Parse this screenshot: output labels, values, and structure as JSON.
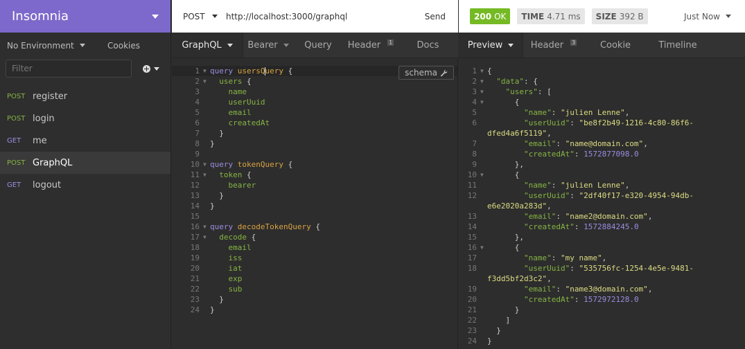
{
  "app": {
    "title": "Insomnia"
  },
  "sidebar": {
    "environment_label": "No Environment",
    "cookies_label": "Cookies",
    "filter_placeholder": "Filter",
    "requests": [
      {
        "method": "POST",
        "name": "register"
      },
      {
        "method": "POST",
        "name": "login"
      },
      {
        "method": "GET",
        "name": "me"
      },
      {
        "method": "POST",
        "name": "GraphQL",
        "active": true
      },
      {
        "method": "GET",
        "name": "logout"
      }
    ]
  },
  "request": {
    "method": "POST",
    "url": "http://localhost:3000/graphql",
    "send_label": "Send",
    "tabs": [
      {
        "label": "GraphQL",
        "active": true,
        "caret": true
      },
      {
        "label": "Bearer",
        "caret": true
      },
      {
        "label": "Query"
      },
      {
        "label": "Header",
        "badge": "1"
      },
      {
        "label": "Docs"
      }
    ],
    "schema_label": "schema"
  },
  "response": {
    "status_code": "200",
    "status_text": "OK",
    "time_label": "TIME",
    "time_value": "4.71 ms",
    "size_label": "SIZE",
    "size_value": "392 B",
    "timestamp": "Just Now",
    "tabs": [
      {
        "label": "Preview",
        "active": true,
        "caret": true
      },
      {
        "label": "Header",
        "badge": "3"
      },
      {
        "label": "Cookie"
      },
      {
        "label": "Timeline"
      }
    ]
  },
  "editor_lines": [
    {
      "n": "1",
      "fold": true,
      "tokens": [
        [
          "kw",
          "query "
        ],
        [
          "qname",
          "usersQ"
        ],
        [
          "cursor",
          ""
        ],
        [
          "qname",
          "uery"
        ],
        [
          "punc",
          " {"
        ]
      ]
    },
    {
      "n": "2",
      "fold": true,
      "tokens": [
        [
          "fld",
          "  users"
        ],
        [
          "punc",
          " {"
        ]
      ]
    },
    {
      "n": "3",
      "tokens": [
        [
          "fld",
          "    name"
        ]
      ]
    },
    {
      "n": "4",
      "tokens": [
        [
          "fld",
          "    userUuid"
        ]
      ]
    },
    {
      "n": "5",
      "tokens": [
        [
          "fld",
          "    email"
        ]
      ]
    },
    {
      "n": "6",
      "tokens": [
        [
          "fld",
          "    createdAt"
        ]
      ]
    },
    {
      "n": "7",
      "tokens": [
        [
          "punc",
          "  }"
        ]
      ]
    },
    {
      "n": "8",
      "tokens": [
        [
          "punc",
          "}"
        ]
      ]
    },
    {
      "n": "9",
      "tokens": []
    },
    {
      "n": "10",
      "fold": true,
      "tokens": [
        [
          "kw",
          "query "
        ],
        [
          "qname",
          "tokenQuery"
        ],
        [
          "punc",
          " {"
        ]
      ]
    },
    {
      "n": "11",
      "fold": true,
      "tokens": [
        [
          "fld",
          "  token"
        ],
        [
          "punc",
          " {"
        ]
      ]
    },
    {
      "n": "12",
      "tokens": [
        [
          "fld",
          "    bearer"
        ]
      ]
    },
    {
      "n": "13",
      "tokens": [
        [
          "punc",
          "  }"
        ]
      ]
    },
    {
      "n": "14",
      "tokens": [
        [
          "punc",
          "}"
        ]
      ]
    },
    {
      "n": "15",
      "tokens": []
    },
    {
      "n": "16",
      "fold": true,
      "tokens": [
        [
          "kw",
          "query "
        ],
        [
          "qname",
          "decodeTokenQuery"
        ],
        [
          "punc",
          " {"
        ]
      ]
    },
    {
      "n": "17",
      "fold": true,
      "tokens": [
        [
          "fld",
          "  decode"
        ],
        [
          "punc",
          " {"
        ]
      ]
    },
    {
      "n": "18",
      "tokens": [
        [
          "fld",
          "    email"
        ]
      ]
    },
    {
      "n": "19",
      "tokens": [
        [
          "fld",
          "    iss"
        ]
      ]
    },
    {
      "n": "20",
      "tokens": [
        [
          "fld",
          "    iat"
        ]
      ]
    },
    {
      "n": "21",
      "tokens": [
        [
          "fld",
          "    exp"
        ]
      ]
    },
    {
      "n": "22",
      "tokens": [
        [
          "fld",
          "    sub"
        ]
      ]
    },
    {
      "n": "23",
      "tokens": [
        [
          "punc",
          "  }"
        ]
      ]
    },
    {
      "n": "24",
      "tokens": [
        [
          "punc",
          "}"
        ]
      ]
    }
  ],
  "response_lines": [
    {
      "n": "1",
      "fold": true,
      "tokens": [
        [
          "punc",
          "{"
        ]
      ]
    },
    {
      "n": "2",
      "fold": true,
      "tokens": [
        [
          "punc",
          "  "
        ],
        [
          "jkey",
          "\"data\""
        ],
        [
          "punc",
          ": {"
        ]
      ]
    },
    {
      "n": "3",
      "fold": true,
      "tokens": [
        [
          "punc",
          "    "
        ],
        [
          "jkey",
          "\"users\""
        ],
        [
          "punc",
          ": ["
        ]
      ]
    },
    {
      "n": "4",
      "fold": true,
      "tokens": [
        [
          "punc",
          "      {"
        ]
      ]
    },
    {
      "n": "5",
      "tokens": [
        [
          "punc",
          "        "
        ],
        [
          "jkey",
          "\"name\""
        ],
        [
          "punc",
          ": "
        ],
        [
          "jstr",
          "\"julien Lenne\""
        ],
        [
          "punc",
          ","
        ]
      ]
    },
    {
      "n": "6",
      "tokens": [
        [
          "punc",
          "        "
        ],
        [
          "jkey",
          "\"userUuid\""
        ],
        [
          "punc",
          ": "
        ],
        [
          "jstr",
          "\"be8f2b49-1216-4c80-86f6-"
        ]
      ]
    },
    {
      "n": "",
      "tokens": [
        [
          "jstr",
          "dfed4a6f5119\""
        ],
        [
          "punc",
          ","
        ]
      ]
    },
    {
      "n": "7",
      "tokens": [
        [
          "punc",
          "        "
        ],
        [
          "jkey",
          "\"email\""
        ],
        [
          "punc",
          ": "
        ],
        [
          "jstr",
          "\"name@domain.com\""
        ],
        [
          "punc",
          ","
        ]
      ]
    },
    {
      "n": "8",
      "tokens": [
        [
          "punc",
          "        "
        ],
        [
          "jkey",
          "\"createdAt\""
        ],
        [
          "punc",
          ": "
        ],
        [
          "jnum",
          "1572877098.0"
        ]
      ]
    },
    {
      "n": "9",
      "tokens": [
        [
          "punc",
          "      },"
        ]
      ]
    },
    {
      "n": "10",
      "fold": true,
      "tokens": [
        [
          "punc",
          "      {"
        ]
      ]
    },
    {
      "n": "11",
      "tokens": [
        [
          "punc",
          "        "
        ],
        [
          "jkey",
          "\"name\""
        ],
        [
          "punc",
          ": "
        ],
        [
          "jstr",
          "\"julien Lenne\""
        ],
        [
          "punc",
          ","
        ]
      ]
    },
    {
      "n": "12",
      "tokens": [
        [
          "punc",
          "        "
        ],
        [
          "jkey",
          "\"userUuid\""
        ],
        [
          "punc",
          ": "
        ],
        [
          "jstr",
          "\"2df40f17-e320-4954-94db-"
        ]
      ]
    },
    {
      "n": "",
      "tokens": [
        [
          "jstr",
          "e6e2020a283d\""
        ],
        [
          "punc",
          ","
        ]
      ]
    },
    {
      "n": "13",
      "tokens": [
        [
          "punc",
          "        "
        ],
        [
          "jkey",
          "\"email\""
        ],
        [
          "punc",
          ": "
        ],
        [
          "jstr",
          "\"name2@domain.com\""
        ],
        [
          "punc",
          ","
        ]
      ]
    },
    {
      "n": "14",
      "tokens": [
        [
          "punc",
          "        "
        ],
        [
          "jkey",
          "\"createdAt\""
        ],
        [
          "punc",
          ": "
        ],
        [
          "jnum",
          "1572884245.0"
        ]
      ]
    },
    {
      "n": "15",
      "tokens": [
        [
          "punc",
          "      },"
        ]
      ]
    },
    {
      "n": "16",
      "fold": true,
      "tokens": [
        [
          "punc",
          "      {"
        ]
      ]
    },
    {
      "n": "17",
      "tokens": [
        [
          "punc",
          "        "
        ],
        [
          "jkey",
          "\"name\""
        ],
        [
          "punc",
          ": "
        ],
        [
          "jstr",
          "\"my name\""
        ],
        [
          "punc",
          ","
        ]
      ]
    },
    {
      "n": "18",
      "tokens": [
        [
          "punc",
          "        "
        ],
        [
          "jkey",
          "\"userUuid\""
        ],
        [
          "punc",
          ": "
        ],
        [
          "jstr",
          "\"535756fc-1254-4e5e-9481-"
        ]
      ]
    },
    {
      "n": "",
      "tokens": [
        [
          "jstr",
          "f3dd5bf2d3c2\""
        ],
        [
          "punc",
          ","
        ]
      ]
    },
    {
      "n": "19",
      "tokens": [
        [
          "punc",
          "        "
        ],
        [
          "jkey",
          "\"email\""
        ],
        [
          "punc",
          ": "
        ],
        [
          "jstr",
          "\"name3@domain.com\""
        ],
        [
          "punc",
          ","
        ]
      ]
    },
    {
      "n": "20",
      "tokens": [
        [
          "punc",
          "        "
        ],
        [
          "jkey",
          "\"createdAt\""
        ],
        [
          "punc",
          ": "
        ],
        [
          "jnum",
          "1572972128.0"
        ]
      ]
    },
    {
      "n": "21",
      "tokens": [
        [
          "punc",
          "      }"
        ]
      ]
    },
    {
      "n": "22",
      "tokens": [
        [
          "punc",
          "    ]"
        ]
      ]
    },
    {
      "n": "23",
      "tokens": [
        [
          "punc",
          "  }"
        ]
      ]
    },
    {
      "n": "24",
      "tokens": [
        [
          "punc",
          "}"
        ]
      ]
    }
  ],
  "colors": {
    "brand": "#7d69cb",
    "ok": "#75ba24",
    "post": "#86b443",
    "get": "#9a8de0"
  }
}
